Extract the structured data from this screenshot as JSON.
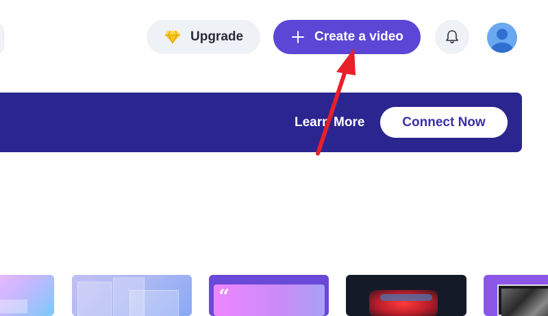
{
  "header": {
    "upgrade_label": "Upgrade",
    "create_label": "Create a video"
  },
  "banner": {
    "learn_more_label": "Learn More",
    "connect_label": "Connect Now"
  },
  "icons": {
    "upgrade": "diamond-icon",
    "create": "plus-icon",
    "notifications": "bell-icon",
    "avatar": "user-icon"
  },
  "colors": {
    "primary": "#5b46d6",
    "banner": "#2b2590",
    "upgrade_gem": "#f5c518",
    "annotation_arrow": "#e8202a"
  }
}
